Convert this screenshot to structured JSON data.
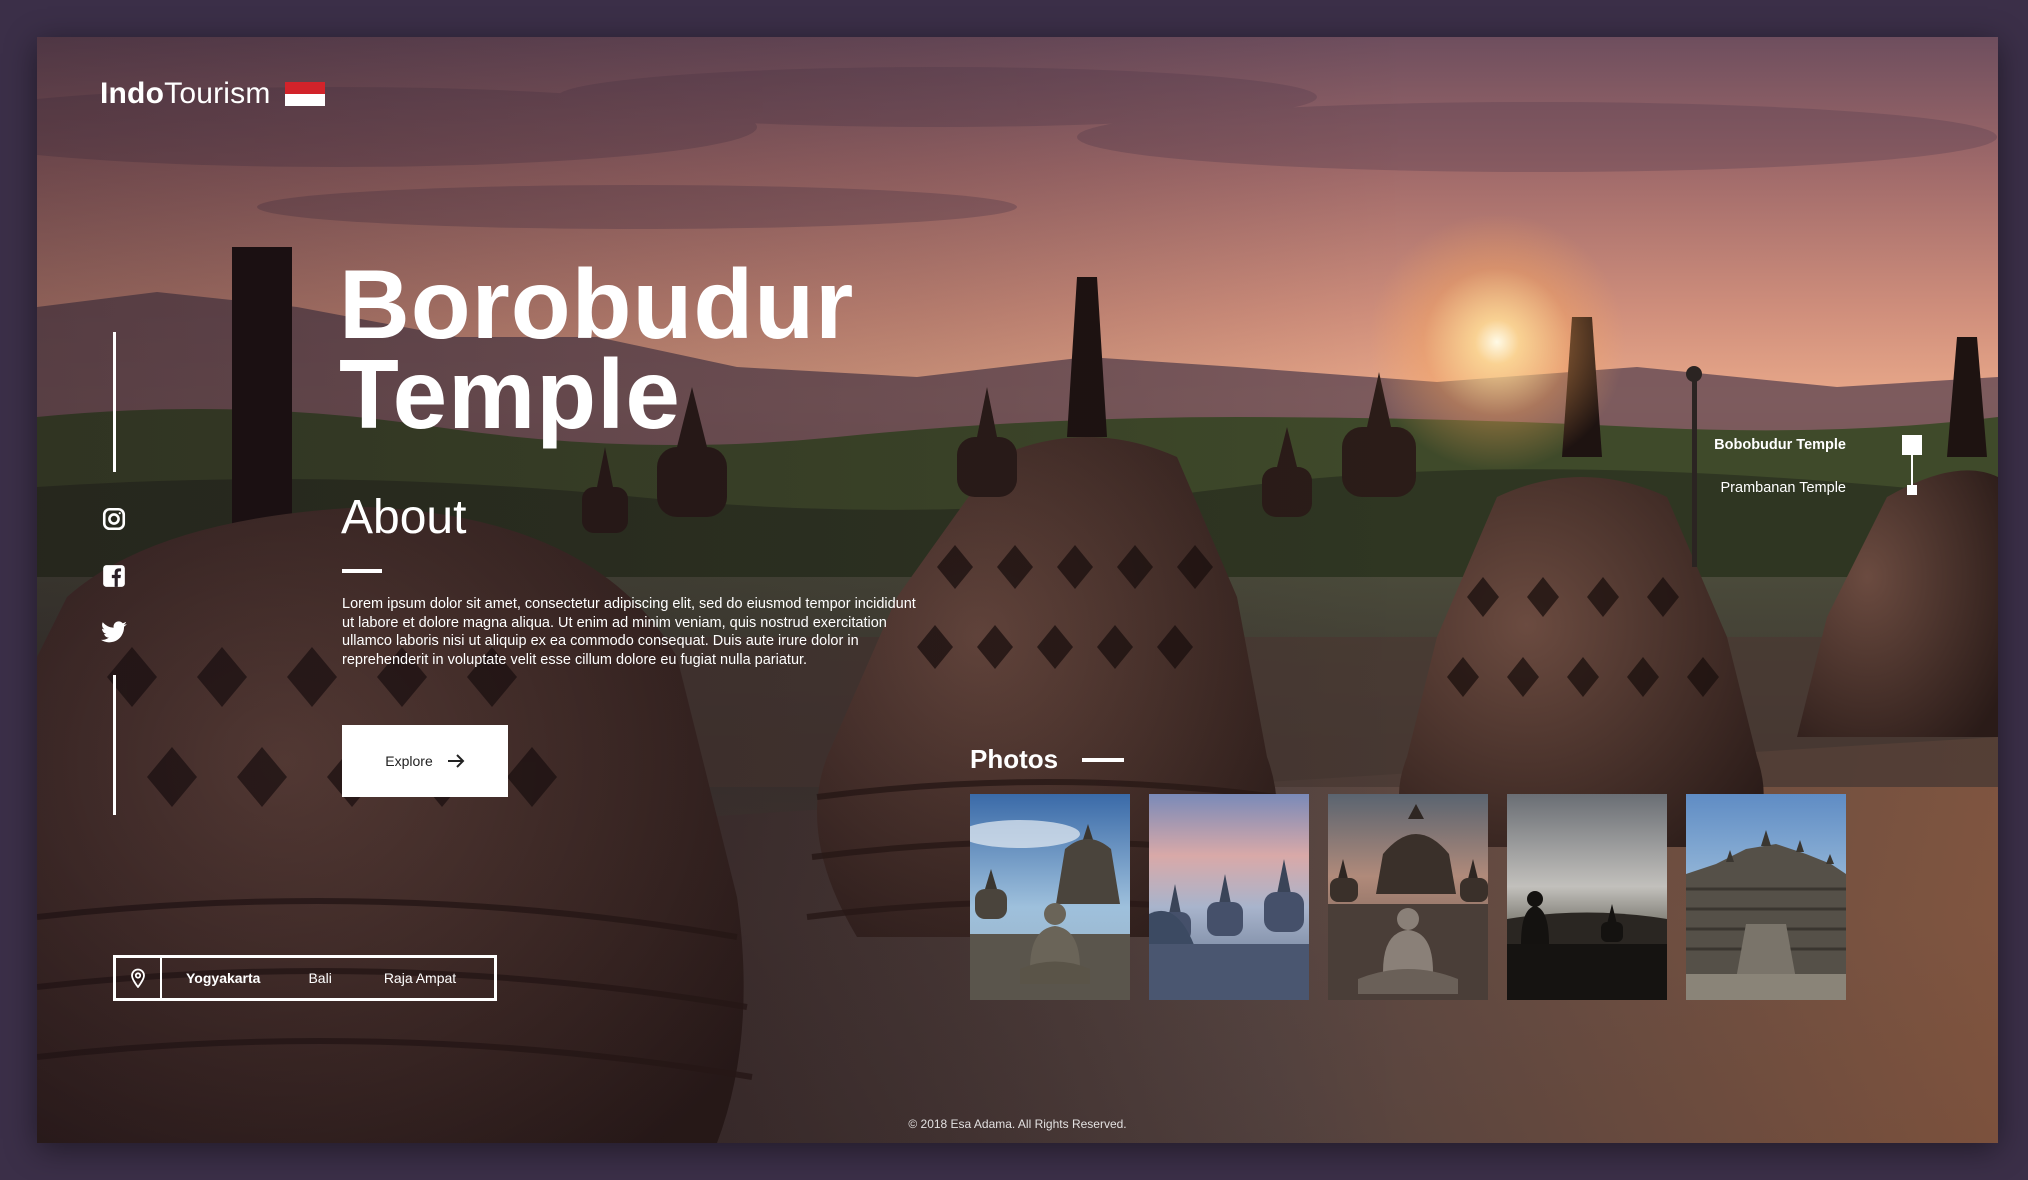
{
  "brand": {
    "bold": "Indo",
    "regular": "Tourism"
  },
  "hero": {
    "title_line1": "Borobudur",
    "title_line2": "Temple"
  },
  "about": {
    "heading": "About",
    "body": "Lorem ipsum dolor sit amet, consectetur adipiscing elit, sed do eiusmod tempor incididunt ut labore et dolore magna aliqua. Ut enim ad minim veniam, quis nostrud exercitation ullamco laboris nisi ut aliquip ex ea commodo consequat. Duis aute irure dolor in reprehenderit in voluptate velit esse cillum dolore eu fugiat nulla pariatur.",
    "button_label": "Explore"
  },
  "social": [
    "instagram-icon",
    "facebook-icon",
    "twitter-icon"
  ],
  "locations": {
    "items": [
      "Yogyakarta",
      "Bali",
      "Raja Ampat"
    ],
    "active": "Yogyakarta"
  },
  "photos": {
    "heading": "Photos",
    "count": 5
  },
  "temple_nav": {
    "items": [
      "Bobobudur Temple",
      "Prambanan Temple"
    ],
    "active": "Bobobudur Temple"
  },
  "footer": {
    "text": "© 2018 Esa Adama. All Rights Reserved."
  },
  "colors": {
    "background": "#3b2f48",
    "flag_red": "#d2232a",
    "accent": "#ffffff"
  }
}
